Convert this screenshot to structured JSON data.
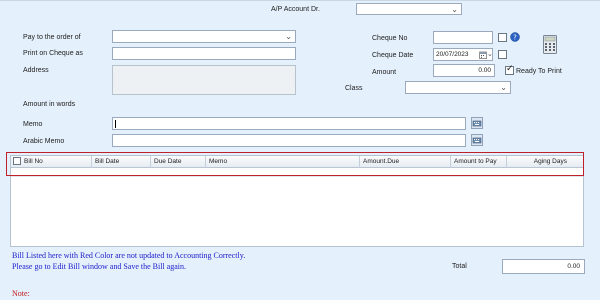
{
  "header": {
    "ap_account_label": "A/P Account Dr.",
    "ap_account_value": ""
  },
  "form": {
    "pay_to_label": "Pay to the order of",
    "pay_to_value": "",
    "print_on_cheque_label": "Print on Cheque as",
    "print_on_cheque_value": "",
    "address_label": "Address",
    "address_value": "",
    "amount_in_words_label": "Amount in words",
    "memo_label": "Memo",
    "memo_value": "",
    "arabic_memo_label": "Arabic Memo",
    "arabic_memo_value": "",
    "cheque_no_label": "Cheque No",
    "cheque_no_value": "",
    "cheque_date_label": "Cheque Date",
    "cheque_date_value": "20/07/2023",
    "amount_label": "Amount",
    "amount_value": "0.00",
    "ready_to_print_label": "Ready To Print",
    "ready_to_print_checked": true,
    "class_label": "Class",
    "class_value": ""
  },
  "grid": {
    "columns": [
      "Bill No",
      "Bill Date",
      "Due Date",
      "Memo",
      "Amount.Due",
      "Amount to Pay",
      "Aging Days"
    ]
  },
  "footer": {
    "warning_line1": "Bill Listed here with Red Color are not updated to Accounting Correctly.",
    "warning_line2": "Please go to Edit Bill window and Save the Bill again.",
    "total_label": "Total",
    "total_value": "0.00",
    "note_label": "Note:"
  },
  "colors": {
    "background": "#e4f0fb",
    "warning_text": "#1a1acc",
    "note_text": "#c01818",
    "grid_frame": "#c0202a"
  },
  "icons": [
    "chevron-down-icon",
    "calendar-icon",
    "help-icon",
    "calculator-icon",
    "keyboard-icon"
  ]
}
